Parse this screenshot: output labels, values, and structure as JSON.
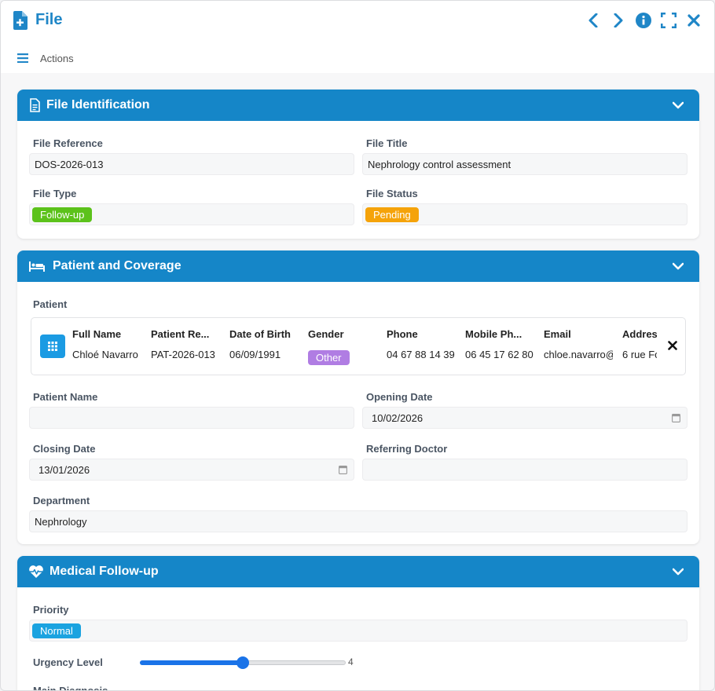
{
  "window": {
    "title": "File",
    "title_color": "#1f86c7"
  },
  "toolbar": {
    "actions_label": "Actions"
  },
  "sections": {
    "identification": {
      "title": "File Identification",
      "file_reference": {
        "label": "File Reference",
        "value": "DOS-2026-013"
      },
      "file_title": {
        "label": "File Title",
        "value": "Nephrology control assessment"
      },
      "file_type": {
        "label": "File Type",
        "value": "Follow-up",
        "color": "#5cc21b"
      },
      "file_status": {
        "label": "File Status",
        "value": "Pending",
        "color": "#f5a30a"
      }
    },
    "patient": {
      "title": "Patient and Coverage",
      "patient_label": "Patient",
      "columns": {
        "full_name": {
          "header": "Full Name",
          "value": "Chloé Navarro"
        },
        "patient_ref": {
          "header": "Patient Re...",
          "value": "PAT-2026-013"
        },
        "dob": {
          "header": "Date of Birth",
          "value": "06/09/1991"
        },
        "gender": {
          "header": "Gender",
          "value": "Other",
          "color": "#b07de3"
        },
        "phone": {
          "header": "Phone",
          "value": "04 67 88 14 39"
        },
        "mobile": {
          "header": "Mobile Ph...",
          "value": "06 45 17 62 80"
        },
        "email": {
          "header": "Email",
          "value": "chloe.navarro@"
        },
        "address": {
          "header": "Addres",
          "value": "6 rue Fo"
        }
      },
      "patient_name": {
        "label": "Patient Name",
        "value": ""
      },
      "opening_date": {
        "label": "Opening Date",
        "value": "10/02/2026"
      },
      "closing_date": {
        "label": "Closing Date",
        "value": "13/01/2026"
      },
      "referring_doctor": {
        "label": "Referring Doctor",
        "value": ""
      },
      "department": {
        "label": "Department",
        "value": "Nephrology"
      }
    },
    "medical": {
      "title": "Medical Follow-up",
      "priority": {
        "label": "Priority",
        "value": "Normal",
        "color": "#1aa3e0"
      },
      "urgency": {
        "label": "Urgency Level",
        "value": "4",
        "min": 1,
        "max": 7
      },
      "main_diagnosis": {
        "label": "Main Diagnosis"
      }
    }
  },
  "theme": {
    "header_blue": "#1586c8",
    "slider_blue": "#1a73e8"
  }
}
